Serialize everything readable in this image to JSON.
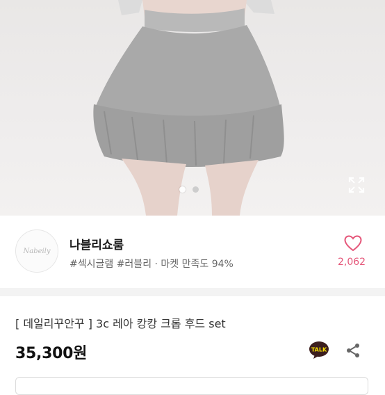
{
  "product_image": {
    "image_count": 2,
    "current_index": 1,
    "expand_icon": "expand-icon"
  },
  "seller": {
    "avatar_text": "Nabeily",
    "name": "나블리쇼룸",
    "tags": "#섹시글램 #러블리 · 마켓 만족도 94%",
    "like_icon": "heart-icon",
    "like_count": "2,062"
  },
  "product": {
    "title": "[ 데일리꾸안꾸 ] 3c 레아 캉캉 크롭 후드 set",
    "price": "35,300원",
    "talk_label": "TALK",
    "share_icon": "share-icon"
  },
  "colors": {
    "accent_pink": "#e5577a",
    "kakao_yellow": "#fae100",
    "kakao_brown": "#3c1e1e"
  }
}
